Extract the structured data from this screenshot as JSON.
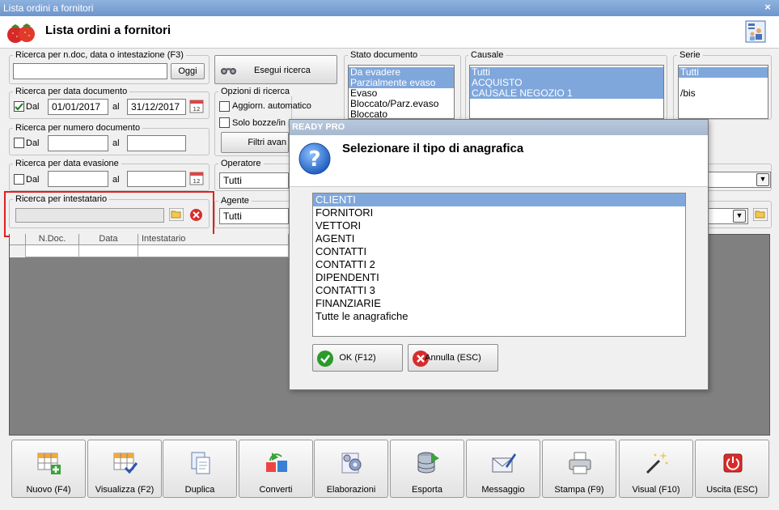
{
  "window": {
    "title": "Lista ordini a fornitori",
    "close": "×"
  },
  "header": {
    "title": "Lista ordini a fornitori"
  },
  "search_text": {
    "label": "Ricerca per n.doc, data o intestazione (F3)",
    "value": "",
    "today_button": "Oggi"
  },
  "search_button": "Esegui ricerca",
  "date_doc": {
    "label": "Ricerca per data documento",
    "dal_label": "Dal",
    "checked": true,
    "from": "01/01/2017",
    "al_label": "al",
    "to": "31/12/2017"
  },
  "num_doc": {
    "label": "Ricerca per numero documento",
    "dal_label": "Dal",
    "al_label": "al",
    "from": "",
    "to": ""
  },
  "date_evasione": {
    "label": "Ricerca per data evasione",
    "dal_label": "Dal",
    "al_label": "al",
    "from": "",
    "to": ""
  },
  "intestatario": {
    "label": "Ricerca per intestatario",
    "value": ""
  },
  "search_options": {
    "label": "Opzioni di ricerca",
    "auto_update": "Aggiorn. automatico",
    "only_drafts": "Solo bozze/in p",
    "advanced_filters": "Filtri avan"
  },
  "operatore": {
    "label": "Operatore",
    "value": "Tutti"
  },
  "agente": {
    "label": "Agente",
    "value": "Tutti"
  },
  "stato_documento": {
    "label": "Stato documento",
    "items": [
      {
        "text": "Da evadere",
        "selected": true
      },
      {
        "text": "Parzialmente evaso",
        "selected": true
      },
      {
        "text": "Evaso",
        "selected": false
      },
      {
        "text": "Bloccato/Parz.evaso",
        "selected": false
      },
      {
        "text": "Bloccato",
        "selected": false
      }
    ]
  },
  "causale": {
    "label": "Causale",
    "items": [
      {
        "text": "Tutti",
        "selected": true
      },
      {
        "text": "ACQUISTO",
        "selected": true
      },
      {
        "text": "CAUSALE NEGOZIO 1",
        "selected": true
      }
    ]
  },
  "serie": {
    "label": "Serie",
    "items": [
      {
        "text": "Tutti",
        "selected": true
      },
      {
        "text": "",
        "selected": false
      },
      {
        "text": "/bis",
        "selected": false
      }
    ]
  },
  "grid": {
    "columns": [
      "N.Doc.",
      "Data",
      "Intestatario"
    ]
  },
  "toolbar": [
    {
      "id": "nuovo",
      "label": "Nuovo (F4)",
      "icon": "grid-add-icon"
    },
    {
      "id": "visualizza",
      "label": "Visualizza (F2)",
      "icon": "grid-check-icon"
    },
    {
      "id": "duplica",
      "label": "Duplica",
      "icon": "duplicate-icon"
    },
    {
      "id": "converti",
      "label": "Converti",
      "icon": "convert-icon"
    },
    {
      "id": "elaborazioni",
      "label": "Elaborazioni",
      "icon": "gears-icon"
    },
    {
      "id": "esporta",
      "label": "Esporta",
      "icon": "database-export-icon"
    },
    {
      "id": "messaggio",
      "label": "Messaggio",
      "icon": "envelope-pen-icon"
    },
    {
      "id": "stampa",
      "label": "Stampa (F9)",
      "icon": "printer-icon"
    },
    {
      "id": "visual",
      "label": "Visual (F10)",
      "icon": "magic-wand-icon"
    },
    {
      "id": "uscita",
      "label": "Uscita (ESC)",
      "icon": "power-icon"
    }
  ],
  "modal": {
    "title": "READY PRO",
    "prompt": "Selezionare il tipo di anagrafica",
    "items": [
      {
        "text": "CLIENTI",
        "selected": true
      },
      {
        "text": "FORNITORI",
        "selected": false
      },
      {
        "text": "VETTORI",
        "selected": false
      },
      {
        "text": "AGENTI",
        "selected": false
      },
      {
        "text": "CONTATTI",
        "selected": false
      },
      {
        "text": "CONTATTI 2",
        "selected": false
      },
      {
        "text": "DIPENDENTI",
        "selected": false
      },
      {
        "text": "CONTATTI 3",
        "selected": false
      },
      {
        "text": "FINANZIARIE",
        "selected": false
      },
      {
        "text": "Tutte le anagrafiche",
        "selected": false
      }
    ],
    "ok": "OK (F12)",
    "cancel": "Annulla (ESC)"
  },
  "colors": {
    "selection": "#7fa7dc",
    "highlight": "#e0201e",
    "grid_bg": "#808080"
  }
}
